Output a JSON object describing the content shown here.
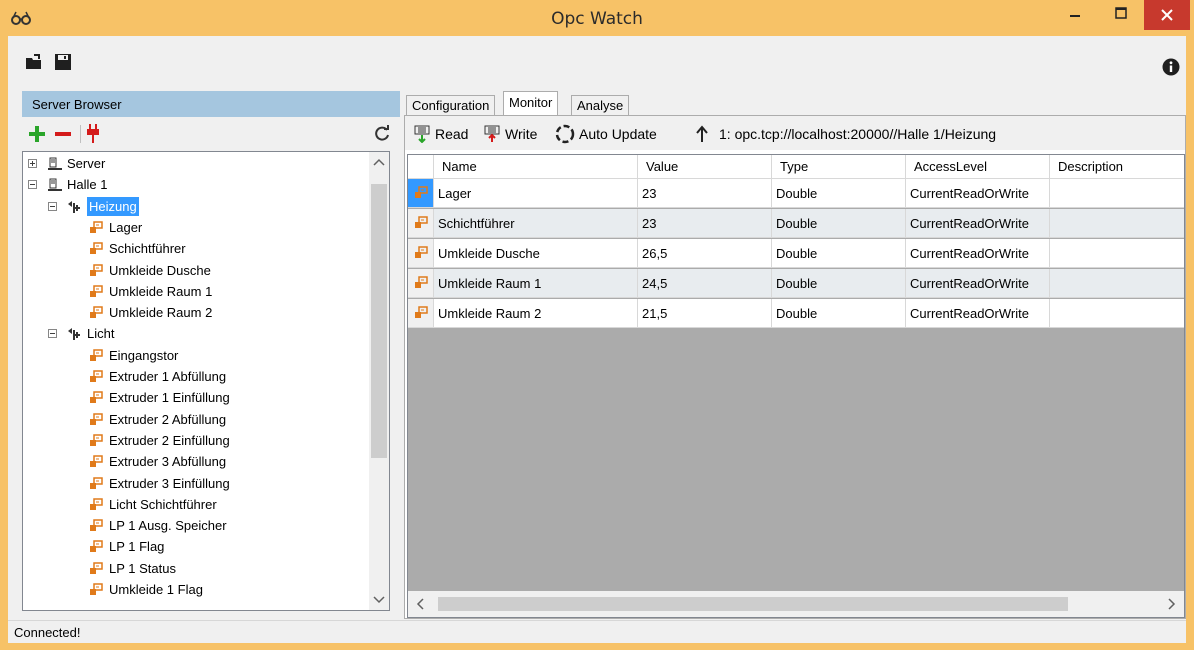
{
  "window": {
    "title": "Opc Watch"
  },
  "toolbar": {
    "open_icon": "open-folder-icon",
    "save_icon": "save-icon",
    "info_icon": "info-icon"
  },
  "server_browser": {
    "header": "Server Browser",
    "tools": {
      "add_icon": "plus-icon",
      "remove_icon": "minus-icon",
      "connect_icon": "plug-icon",
      "refresh_icon": "refresh-icon"
    },
    "tree": [
      {
        "label": "Server",
        "level": 0,
        "expander": "plus",
        "icon": "server-icon"
      },
      {
        "label": "Halle 1",
        "level": 0,
        "expander": "minus",
        "icon": "server-icon"
      },
      {
        "label": "Heizung",
        "level": 1,
        "expander": "minus",
        "icon": "folder-tag-icon",
        "selected": true
      },
      {
        "label": "Lager",
        "level": 2,
        "icon": "variable-icon"
      },
      {
        "label": "Schichtführer",
        "level": 2,
        "icon": "variable-icon"
      },
      {
        "label": "Umkleide Dusche",
        "level": 2,
        "icon": "variable-icon"
      },
      {
        "label": "Umkleide Raum 1",
        "level": 2,
        "icon": "variable-icon"
      },
      {
        "label": "Umkleide Raum 2",
        "level": 2,
        "icon": "variable-icon"
      },
      {
        "label": "Licht",
        "level": 1,
        "expander": "minus",
        "icon": "folder-tag-icon"
      },
      {
        "label": "Eingangstor",
        "level": 2,
        "icon": "variable-icon"
      },
      {
        "label": "Extruder 1 Abfüllung",
        "level": 2,
        "icon": "variable-icon"
      },
      {
        "label": "Extruder 1 Einfüllung",
        "level": 2,
        "icon": "variable-icon"
      },
      {
        "label": "Extruder 2 Abfüllung",
        "level": 2,
        "icon": "variable-icon"
      },
      {
        "label": "Extruder 2 Einfüllung",
        "level": 2,
        "icon": "variable-icon"
      },
      {
        "label": "Extruder 3 Abfüllung",
        "level": 2,
        "icon": "variable-icon"
      },
      {
        "label": "Extruder 3 Einfüllung",
        "level": 2,
        "icon": "variable-icon"
      },
      {
        "label": "Licht Schichtführer",
        "level": 2,
        "icon": "variable-icon"
      },
      {
        "label": "LP 1 Ausg. Speicher",
        "level": 2,
        "icon": "variable-icon"
      },
      {
        "label": "LP 1 Flag",
        "level": 2,
        "icon": "variable-icon"
      },
      {
        "label": "LP 1 Status",
        "level": 2,
        "icon": "variable-icon"
      },
      {
        "label": "Umkleide 1 Flag",
        "level": 2,
        "icon": "variable-icon"
      }
    ]
  },
  "tabs": [
    {
      "label": "Configuration",
      "active": false
    },
    {
      "label": "Monitor",
      "active": true
    },
    {
      "label": "Analyse",
      "active": false
    }
  ],
  "monitor": {
    "read_label": "Read",
    "write_label": "Write",
    "auto_update_label": "Auto Update",
    "path": "1: opc.tcp://localhost:20000//Halle 1/Heizung",
    "columns": [
      "Name",
      "Value",
      "Type",
      "AccessLevel",
      "Description"
    ],
    "rows": [
      {
        "name": "Lager",
        "value": "23",
        "type": "Double",
        "access": "CurrentReadOrWrite",
        "description": ""
      },
      {
        "name": "Schichtführer",
        "value": "23",
        "type": "Double",
        "access": "CurrentReadOrWrite",
        "description": ""
      },
      {
        "name": "Umkleide Dusche",
        "value": "26,5",
        "type": "Double",
        "access": "CurrentReadOrWrite",
        "description": ""
      },
      {
        "name": "Umkleide Raum 1",
        "value": "24,5",
        "type": "Double",
        "access": "CurrentReadOrWrite",
        "description": ""
      },
      {
        "name": "Umkleide Raum 2",
        "value": "21,5",
        "type": "Double",
        "access": "CurrentReadOrWrite",
        "description": ""
      }
    ]
  },
  "status": {
    "text": "Connected!"
  },
  "colors": {
    "frame": "#f7c267",
    "close": "#c7392d",
    "selection": "#3399ff",
    "header": "#a5c6df"
  }
}
